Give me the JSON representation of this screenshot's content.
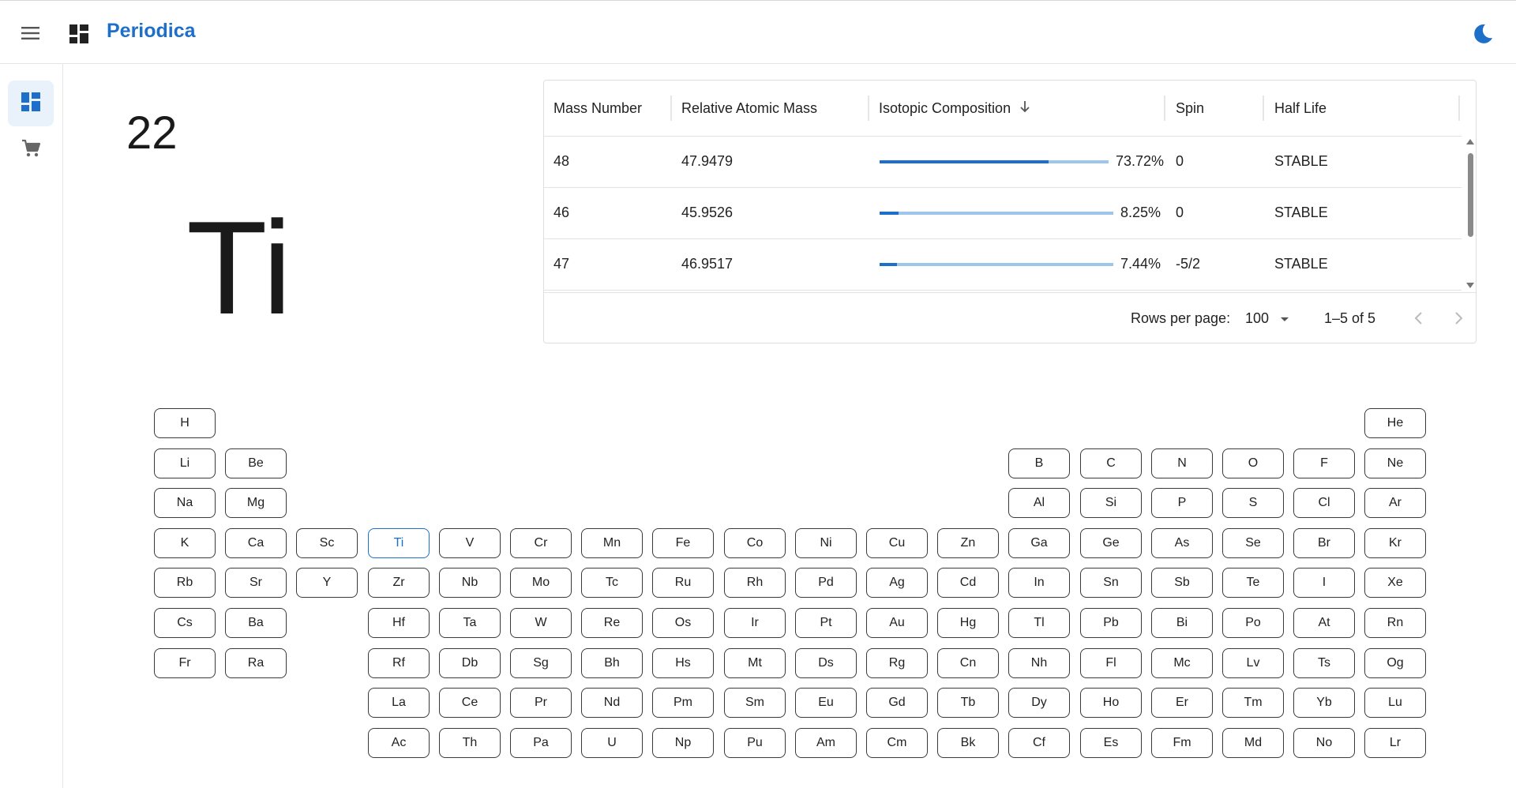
{
  "app": {
    "title": "Periodica",
    "menu_icon": "hamburger-menu-icon",
    "logo_icon": "dashboard-grid-icon",
    "theme_icon": "dark-mode-moon-icon",
    "accent_color": "#1e6fc9"
  },
  "sidebar": {
    "items": [
      {
        "icon": "dashboard-icon",
        "active": true
      },
      {
        "icon": "shopping-cart-icon",
        "active": false
      }
    ]
  },
  "element": {
    "atomic_number": "22",
    "symbol": "Ti"
  },
  "isotopes": {
    "columns": [
      "Mass Number",
      "Relative Atomic Mass",
      "Isotopic Composition",
      "Spin",
      "Half Life"
    ],
    "sort_icon": "arrow-down-icon",
    "rows": [
      {
        "mass_number": "48",
        "relative_atomic_mass": "47.9479",
        "composition": "73.72%",
        "composition_value": 0.7372,
        "spin": "0",
        "half_life": "STABLE"
      },
      {
        "mass_number": "46",
        "relative_atomic_mass": "45.9526",
        "composition": "8.25%",
        "composition_value": 0.0825,
        "spin": "0",
        "half_life": "STABLE"
      },
      {
        "mass_number": "47",
        "relative_atomic_mass": "46.9517",
        "composition": "7.44%",
        "composition_value": 0.0744,
        "spin": "-5/2",
        "half_life": "STABLE"
      }
    ],
    "footer": {
      "rows_per_page_label": "Rows per page:",
      "rows_per_page_value": "100",
      "range": "1–5 of 5",
      "prev_icon": "chevron-left-icon",
      "next_icon": "chevron-right-icon"
    }
  },
  "periodic_table": {
    "selected": "Ti",
    "rows": [
      [
        "H",
        "",
        "",
        "",
        "",
        "",
        "",
        "",
        "",
        "",
        "",
        "",
        "",
        "",
        "",
        "",
        "",
        "He"
      ],
      [
        "Li",
        "Be",
        "",
        "",
        "",
        "",
        "",
        "",
        "",
        "",
        "",
        "",
        "B",
        "C",
        "N",
        "O",
        "F",
        "Ne"
      ],
      [
        "Na",
        "Mg",
        "",
        "",
        "",
        "",
        "",
        "",
        "",
        "",
        "",
        "",
        "Al",
        "Si",
        "P",
        "S",
        "Cl",
        "Ar"
      ],
      [
        "K",
        "Ca",
        "Sc",
        "Ti",
        "V",
        "Cr",
        "Mn",
        "Fe",
        "Co",
        "Ni",
        "Cu",
        "Zn",
        "Ga",
        "Ge",
        "As",
        "Se",
        "Br",
        "Kr"
      ],
      [
        "Rb",
        "Sr",
        "Y",
        "Zr",
        "Nb",
        "Mo",
        "Tc",
        "Ru",
        "Rh",
        "Pd",
        "Ag",
        "Cd",
        "In",
        "Sn",
        "Sb",
        "Te",
        "I",
        "Xe"
      ],
      [
        "Cs",
        "Ba",
        "",
        "Hf",
        "Ta",
        "W",
        "Re",
        "Os",
        "Ir",
        "Pt",
        "Au",
        "Hg",
        "Tl",
        "Pb",
        "Bi",
        "Po",
        "At",
        "Rn"
      ],
      [
        "Fr",
        "Ra",
        "",
        "Rf",
        "Db",
        "Sg",
        "Bh",
        "Hs",
        "Mt",
        "Ds",
        "Rg",
        "Cn",
        "Nh",
        "Fl",
        "Mc",
        "Lv",
        "Ts",
        "Og"
      ],
      [
        "",
        "",
        "",
        "La",
        "Ce",
        "Pr",
        "Nd",
        "Pm",
        "Sm",
        "Eu",
        "Gd",
        "Tb",
        "Dy",
        "Ho",
        "Er",
        "Tm",
        "Yb",
        "Lu"
      ],
      [
        "",
        "",
        "",
        "Ac",
        "Th",
        "Pa",
        "U",
        "Np",
        "Pu",
        "Am",
        "Cm",
        "Bk",
        "Cf",
        "Es",
        "Fm",
        "Md",
        "No",
        "Lr"
      ]
    ]
  }
}
